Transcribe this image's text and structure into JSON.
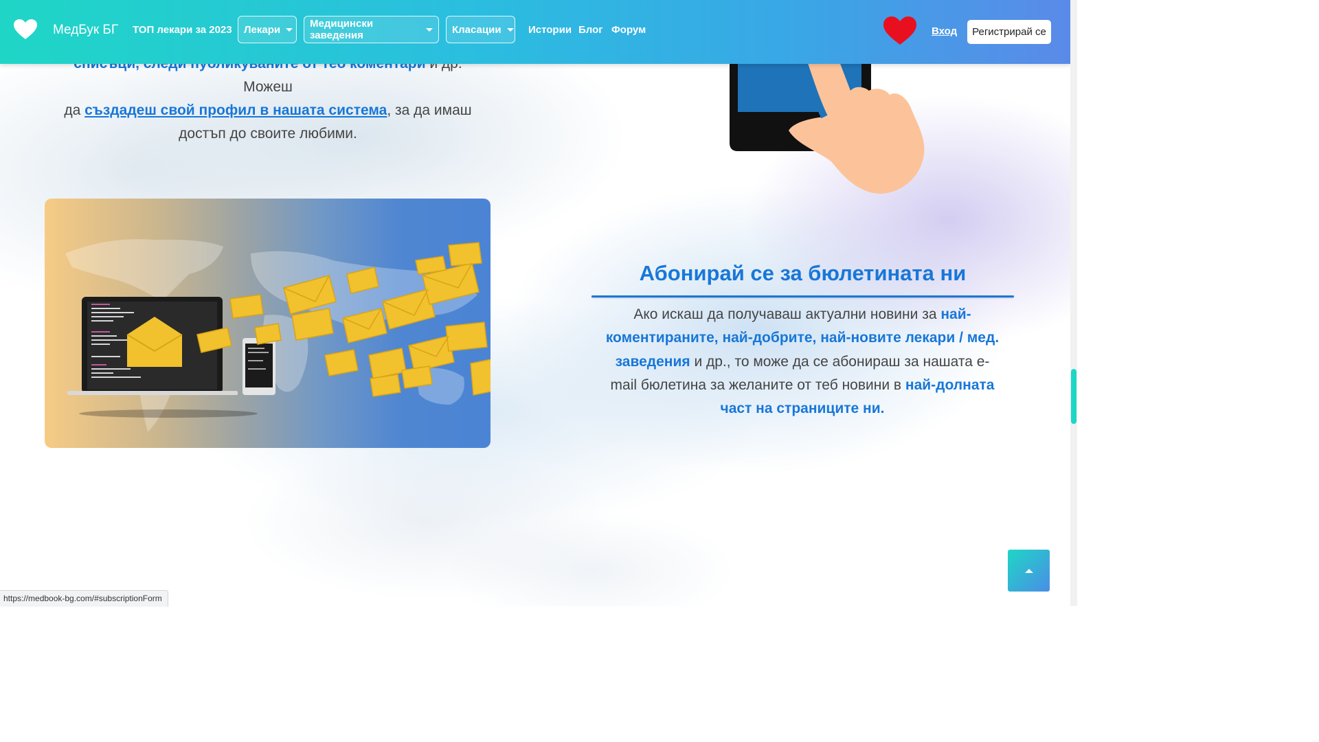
{
  "navbar": {
    "brand": "МедБук БГ",
    "top_doctors": "ТОП лекари за 2023",
    "doctors_dropdown": "Лекари",
    "institutions_dropdown": "Медицински заведения",
    "rankings_dropdown": "Класации",
    "stories": "Истории",
    "blog": "Блог",
    "forum": "Форум",
    "login": "Вход",
    "register": "Регистрирай се"
  },
  "intro": {
    "line1_strong": "списъци, следи публикуваните от теб коментари",
    "line1_rest": " и др. Можеш",
    "line2_pre": "да ",
    "line2_link": "създадеш свой профил в нашата система",
    "line2_post": ", за да имаш",
    "line3": "достъп до своите любими."
  },
  "newsletter": {
    "title": "Абонирай се за бюлетината ни",
    "p1": "Ако искаш да получаваш актуални новини за ",
    "s1": "най-коментираните, най-добрите, най-новите лекари / мед. заведения",
    "p2": " и др., то може да се абонираш за нашата e-mail бюлетина за желаните от теб новини в ",
    "s2": "най-долната част на страниците ни."
  },
  "status_url": "https://medbook-bg.com/#subscriptionForm",
  "colors": {
    "accent": "#1877d8",
    "nav_start": "#1fd6c6",
    "nav_end": "#5a8ae8",
    "heart_red": "#e8101e"
  },
  "icons": {
    "brand": "heart-icon",
    "favorites": "heart-icon",
    "scroll_top": "chevron-up-icon"
  }
}
